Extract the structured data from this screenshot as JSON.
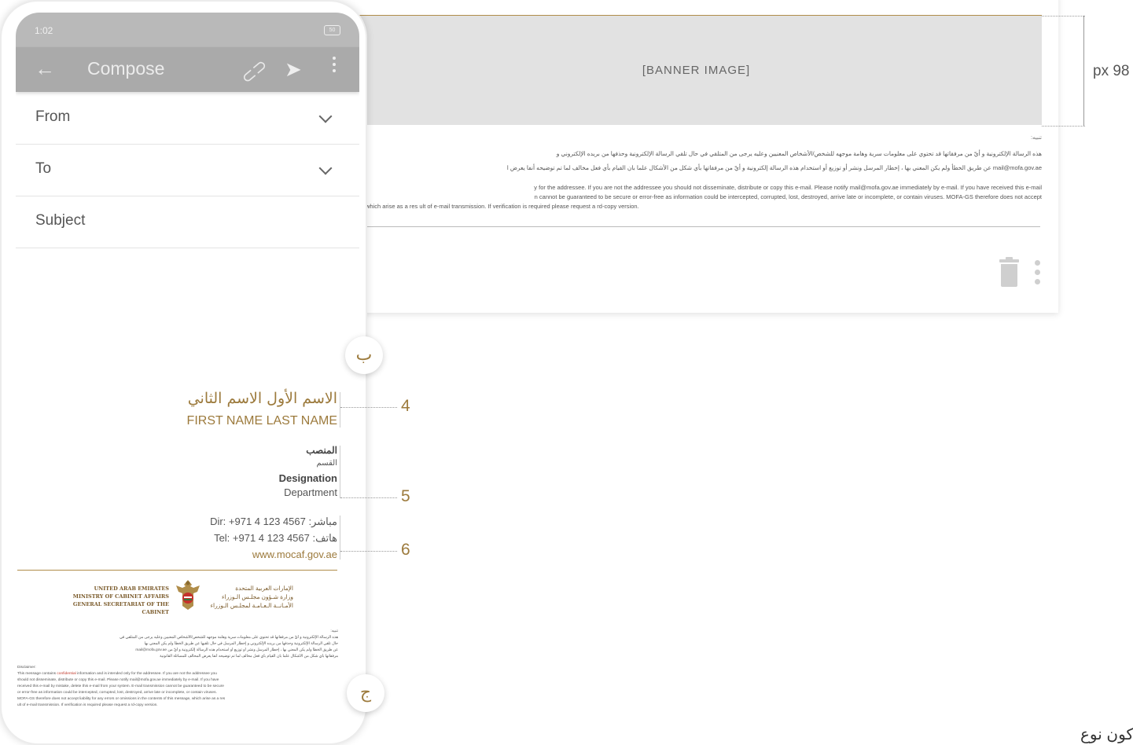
{
  "desktop": {
    "banner_text": "[BANNER IMAGE]",
    "dimension_label": "px 98",
    "disclaimer_ar_heading": "تنبيه:",
    "disclaimer_ar_1": "هذه الرسالة الإلكترونية و أيّ من مرفقاتها قد تحتوي على معلومات سرية وهامة موجهه للشخص/الأشخاص المعنيين وعليه يرجى من المتلقي في حال تلقي الرسالة الإلكترونية وحذفها من بريده الإلكتروني و",
    "disclaimer_ar_2": "عن طريق الخطأ ولم يكن المعني بها ، إخطار المرسل ونشر أو توزيع أو استخدام هذه الرسالة إلكترونية و أيّ من مرفقاتها بأي شكل من الأشكال علما بان القيام بأي فعل مخالف لما تم توضيحه أنفا يعرض ا",
    "disclaimer_ar_email": "mail@mofa.gov.ae",
    "disclaimer_en_1": "y for the addressee. If you are not the addressee you should not disseminate, distribute or copy this e-mail. Please notify mail@mofa.gov.ae immediately by e-mail. If you have received this e-mail",
    "disclaimer_en_2": "n cannot be guaranteed to be secure or error-free as information could be intercepted, corrupted, lost, destroyed, arrive late or incomplete, or contain viruses. MOFA-GS therefore does not accept",
    "disclaimer_en_3": "which arise as a res ult of e-mail transmission. If verification is required please request a rd-copy version.",
    "corner_text": "كون نوع"
  },
  "phone": {
    "time": "1:02",
    "battery": "50",
    "app_title": "Compose",
    "fields": {
      "from": "From",
      "to": "To",
      "subject": "Subject"
    },
    "signature": {
      "name_ar": "الاسم الأول الاسم الثاني",
      "name_en": "FIRST NAME LAST NAME",
      "designation_ar": "المنصب",
      "department_ar": "القسم",
      "designation_en": "Designation",
      "department_en": "Department",
      "direct": "Dir:  +971 4 123 4567  :مباشر",
      "tel": "Tel: +971 4 123 4567 :هاتف",
      "website": "www.mocaf.gov.ae"
    },
    "logo": {
      "en_1": "UNITED ARAB EMIRATES",
      "en_2": "MINISTRY OF CABINET AFFAIRS",
      "en_3": "GENERAL SECRETARIAT OF THE CABINET",
      "ar_1": "الإمارات العربية المتحدة",
      "ar_2": "وزارة شـؤون مجلـس الـوزراء",
      "ar_3": "الأمـانــة الـعـامـة لمجلـس الـوزراء"
    },
    "mini_disclaimer": {
      "ar_heading": "تنبيه:",
      "ar_1": "هذه الرسالة الإلكترونية و أيّ من مرفقاتها قد تحتوي على معلومات سرية وهامة موجهه للشخص/الأشخاص المعنيين وعليه يرجى من المتلقي في",
      "ar_2": "حال تلقي الرسالة الإلكترونية وحذفها من بريده الإلكتروني و إخطار المرسل في حال تلقيها عن طريق الخطأ ولم يكن المعني بها",
      "ar_3": "عن طريق الخطأ ولم يكن المعني بها ، إخطار المرسل ونشر أو توزيع أو استخدام هذه الرسالة إلكترونية و أيّ من mail@mofa.gov.ae",
      "ar_4": "مرفقاتها بأي شكل من الأشكال علما بان القيام بأي فعل مخالف لما تم توضيحه أنفا يعرض المخالف للمسائلة القانونية",
      "en_heading": "Disclaimer:",
      "en_1_pre": "This message contains ",
      "en_1_red": "confidential",
      "en_1_post": " information and is intended only for the addressee. If you are not the addressee you",
      "en_2": "should not disseminate, distribute or copy this e-mail. Please notify mail@mofa.gov.ae immediately by e-mail. If you have",
      "en_3": "received this e-mail by mistake, delete this e-mail from your system. E-mail transmission cannot be guaranteed to be secure",
      "en_4": "or error-free as information could be intercepted, corrupted, lost, destroyed, arrive late or incomplete, or contain viruses.",
      "en_5": "MOFA-GS therefore does not accept liability for any errors or omissions in the contents of this message, which arise as a res",
      "en_6": "ult of e-mail transmission. If verification is required please request a rd-copy version."
    }
  },
  "callouts": {
    "b": "ب",
    "j": "ج",
    "n4": "4",
    "n5": "5",
    "n6": "6"
  },
  "colors": {
    "accent_gold": "#9c7a3c",
    "banner_gray": "#e2e2e2",
    "appbar_gray": "#aaaaaa"
  }
}
